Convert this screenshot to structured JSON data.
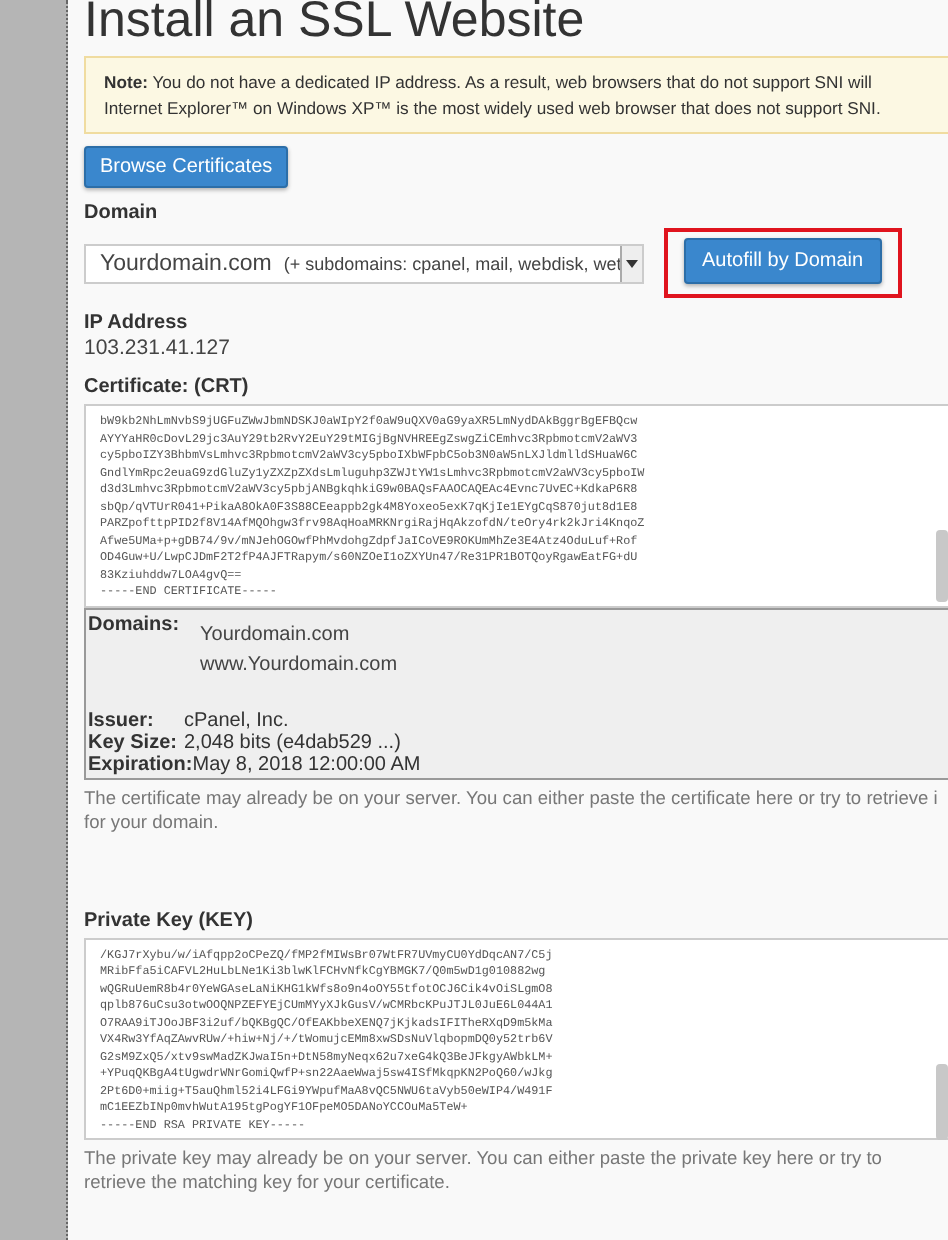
{
  "page_title": "Install an SSL Website",
  "note": {
    "text": "**Note:** You do not have a dedicated IP address. As a result, web browsers that do not support SNI will",
    "text2": "Internet Explorer™ on Windows XP™ is the most widely used web browser that does not support SNI."
  },
  "browse_button": "Browse Certificates",
  "domain": {
    "label": "Domain",
    "value": "Yourdomain.com",
    "subdomains": "(+ subdomains: cpanel, mail, webdisk, wet"
  },
  "autofill_button": {
    "label": "Autofill by Domain",
    "highlighted": true
  },
  "ip_address": {
    "label": "IP Address",
    "value": "103.231.41.127"
  },
  "certificate": {
    "label": "Certificate: (CRT)",
    "lines": [
      "bW9kb2NhLmNvbS9jUGFuZWwJbmNDSKJ0aWIpY2f0aW9uQXV0aG9yaXR5LmNydDAkBggrBgEFBQcw",
      "AYYYaHR0cDovL29jc3AuY29tb2RvY2EuY29tMIGjBgNVHREEgZswgZiCEmhvc3RpbmotcmV2aWV3",
      "cy5pboIZY3BhbmVsLmhvc3RpbmotcmV2aWV3cy5pboIXbWFpbC5ob3N0aW5nLXJldmlldSHuaW6C",
      "GndlYmRpc2euaG9zdGluZy1yZXZpZXdsLmluguhp3ZWJtYW1sLmhvc3RpbmotcmV2aWV3cy5pboIW",
      "d3d3Lmhvc3RpbmotcmV2aWV3cy5pbjANBgkqhkiG9w0BAQsFAAOCAQEAc4Evnc7UvEC+KdkaP6R8",
      "sbQp/qVTUrR041+PikaA8OkA0F3S88CEeappb2gk4M8Yoxeo5exK7qKjIe1EYgCqS870jut8d1E8",
      "PARZpofttpPID2f8V14AfMQOhgw3frv98AqHoaMRKNrgiRajHqAkzofdN/teOry4rk2kJri4KnqoZ",
      "Afwe5UMa+p+gDB74/9v/mNJehOGOwfPhMvdohgZdpfJaICoVE9ROKUmMhZe3E4Atz4OduLuf+Rof",
      "OD4Guw+U/LwpCJDmF2T2fP4AJFTRapym/s60NZOeI1oZXYUn47/Re31PR1BOTQoyRgawEatFG+dU",
      "83Kziuhddw7LOA4gvQ==",
      "-----END CERTIFICATE-----"
    ]
  },
  "details": {
    "domains_label": "Domains:",
    "domains": [
      "Yourdomain.com",
      "www.Yourdomain.com"
    ],
    "rows": [
      {
        "label": "Issuer:",
        "value": "cPanel, Inc."
      },
      {
        "label": "Key Size:",
        "value": "2,048 bits (e4dab529 ...)"
      },
      {
        "label": "Expiration:",
        "value": "May 8, 2018 12:00:00 AM"
      }
    ]
  },
  "certificate_help": "The certificate may already be on your server. You can either paste the certificate here or try to retrieve i for your domain.",
  "private_key": {
    "label": "Private Key (KEY)",
    "lines": [
      "/KGJ7rXybu/w/iAfqpp2oCPeZQ/fMP2fMIWsBr07WtFR7UVmyCU0YdDqcAN7/C5j",
      "MRibFfa5iCAFVL2HuLbLNe1Ki3blwKlFCHvNfkCgYBMGK7/Q0m5wD1g010882wg",
      "wQGRuUemR8b4r0YeWGAseLaNiKHG1kWfs8o9n4oOY55tfotOCJ6Cik4vOiSLgmO8",
      "qplb876uCsu3otwOOQNPZEFYEjCUmMYyXJkGusV/wCMRbcKPuJTJL0JuE6L044A1",
      "O7RAA9iTJOoJBF3i2uf/bQKBgQC/OfEAKbbeXENQ7jKjkadsIFITheRXqD9m5kMa",
      "VX4Rw3YfAqZAwvRUw/+hiw+Nj/+/tWomujcEMm8xwSDsNuVlqbopmDQ0y52trb6V",
      "G2sM9ZxQ5/xtv9swMadZKJwaI5n+DtN58myNeqx62u7xeG4kQ3BeJFkgyAWbkLM+",
      "+YPuqQKBgA4tUgwdrWNrGomiQwfP+sn22AaeWwaj5sw4ISfMkqpKN2PoQ60/wJkg",
      "2Pt6D0+miig+T5auQhml52i4LFGi9YWpufMaA8vQC5NWU6taVyb50eWIP4/W491F",
      "mC1EEZbINp0mvhWutA195tgPogYF1OFpeMO5DANoYCCOuMa5TeW+",
      "-----END RSA PRIVATE KEY-----"
    ]
  },
  "private_key_help": "The private key may already be on your server. You can either paste the private key here or try to retrieve the matching key for your certificate."
}
